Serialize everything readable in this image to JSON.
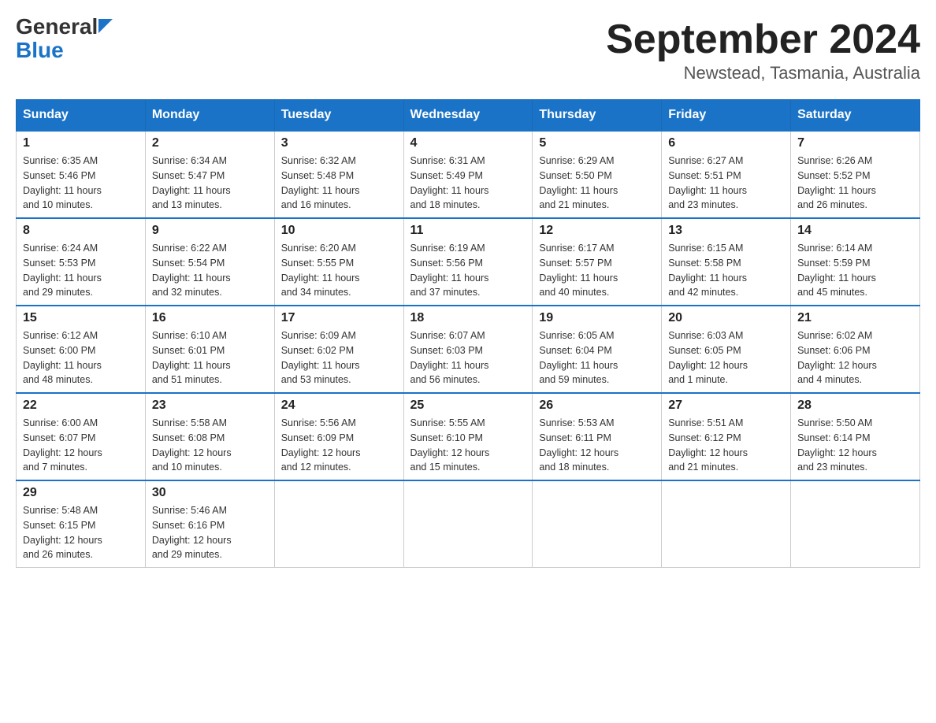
{
  "header": {
    "logo_text1": "General",
    "logo_text2": "Blue",
    "month_title": "September 2024",
    "location": "Newstead, Tasmania, Australia"
  },
  "days_of_week": [
    "Sunday",
    "Monday",
    "Tuesday",
    "Wednesday",
    "Thursday",
    "Friday",
    "Saturday"
  ],
  "weeks": [
    [
      {
        "day": "1",
        "sunrise": "6:35 AM",
        "sunset": "5:46 PM",
        "daylight": "11 hours and 10 minutes."
      },
      {
        "day": "2",
        "sunrise": "6:34 AM",
        "sunset": "5:47 PM",
        "daylight": "11 hours and 13 minutes."
      },
      {
        "day": "3",
        "sunrise": "6:32 AM",
        "sunset": "5:48 PM",
        "daylight": "11 hours and 16 minutes."
      },
      {
        "day": "4",
        "sunrise": "6:31 AM",
        "sunset": "5:49 PM",
        "daylight": "11 hours and 18 minutes."
      },
      {
        "day": "5",
        "sunrise": "6:29 AM",
        "sunset": "5:50 PM",
        "daylight": "11 hours and 21 minutes."
      },
      {
        "day": "6",
        "sunrise": "6:27 AM",
        "sunset": "5:51 PM",
        "daylight": "11 hours and 23 minutes."
      },
      {
        "day": "7",
        "sunrise": "6:26 AM",
        "sunset": "5:52 PM",
        "daylight": "11 hours and 26 minutes."
      }
    ],
    [
      {
        "day": "8",
        "sunrise": "6:24 AM",
        "sunset": "5:53 PM",
        "daylight": "11 hours and 29 minutes."
      },
      {
        "day": "9",
        "sunrise": "6:22 AM",
        "sunset": "5:54 PM",
        "daylight": "11 hours and 32 minutes."
      },
      {
        "day": "10",
        "sunrise": "6:20 AM",
        "sunset": "5:55 PM",
        "daylight": "11 hours and 34 minutes."
      },
      {
        "day": "11",
        "sunrise": "6:19 AM",
        "sunset": "5:56 PM",
        "daylight": "11 hours and 37 minutes."
      },
      {
        "day": "12",
        "sunrise": "6:17 AM",
        "sunset": "5:57 PM",
        "daylight": "11 hours and 40 minutes."
      },
      {
        "day": "13",
        "sunrise": "6:15 AM",
        "sunset": "5:58 PM",
        "daylight": "11 hours and 42 minutes."
      },
      {
        "day": "14",
        "sunrise": "6:14 AM",
        "sunset": "5:59 PM",
        "daylight": "11 hours and 45 minutes."
      }
    ],
    [
      {
        "day": "15",
        "sunrise": "6:12 AM",
        "sunset": "6:00 PM",
        "daylight": "11 hours and 48 minutes."
      },
      {
        "day": "16",
        "sunrise": "6:10 AM",
        "sunset": "6:01 PM",
        "daylight": "11 hours and 51 minutes."
      },
      {
        "day": "17",
        "sunrise": "6:09 AM",
        "sunset": "6:02 PM",
        "daylight": "11 hours and 53 minutes."
      },
      {
        "day": "18",
        "sunrise": "6:07 AM",
        "sunset": "6:03 PM",
        "daylight": "11 hours and 56 minutes."
      },
      {
        "day": "19",
        "sunrise": "6:05 AM",
        "sunset": "6:04 PM",
        "daylight": "11 hours and 59 minutes."
      },
      {
        "day": "20",
        "sunrise": "6:03 AM",
        "sunset": "6:05 PM",
        "daylight": "12 hours and 1 minute."
      },
      {
        "day": "21",
        "sunrise": "6:02 AM",
        "sunset": "6:06 PM",
        "daylight": "12 hours and 4 minutes."
      }
    ],
    [
      {
        "day": "22",
        "sunrise": "6:00 AM",
        "sunset": "6:07 PM",
        "daylight": "12 hours and 7 minutes."
      },
      {
        "day": "23",
        "sunrise": "5:58 AM",
        "sunset": "6:08 PM",
        "daylight": "12 hours and 10 minutes."
      },
      {
        "day": "24",
        "sunrise": "5:56 AM",
        "sunset": "6:09 PM",
        "daylight": "12 hours and 12 minutes."
      },
      {
        "day": "25",
        "sunrise": "5:55 AM",
        "sunset": "6:10 PM",
        "daylight": "12 hours and 15 minutes."
      },
      {
        "day": "26",
        "sunrise": "5:53 AM",
        "sunset": "6:11 PM",
        "daylight": "12 hours and 18 minutes."
      },
      {
        "day": "27",
        "sunrise": "5:51 AM",
        "sunset": "6:12 PM",
        "daylight": "12 hours and 21 minutes."
      },
      {
        "day": "28",
        "sunrise": "5:50 AM",
        "sunset": "6:14 PM",
        "daylight": "12 hours and 23 minutes."
      }
    ],
    [
      {
        "day": "29",
        "sunrise": "5:48 AM",
        "sunset": "6:15 PM",
        "daylight": "12 hours and 26 minutes."
      },
      {
        "day": "30",
        "sunrise": "5:46 AM",
        "sunset": "6:16 PM",
        "daylight": "12 hours and 29 minutes."
      },
      null,
      null,
      null,
      null,
      null
    ]
  ],
  "labels": {
    "sunrise_prefix": "Sunrise: ",
    "sunset_prefix": "Sunset: ",
    "daylight_prefix": "Daylight: "
  }
}
